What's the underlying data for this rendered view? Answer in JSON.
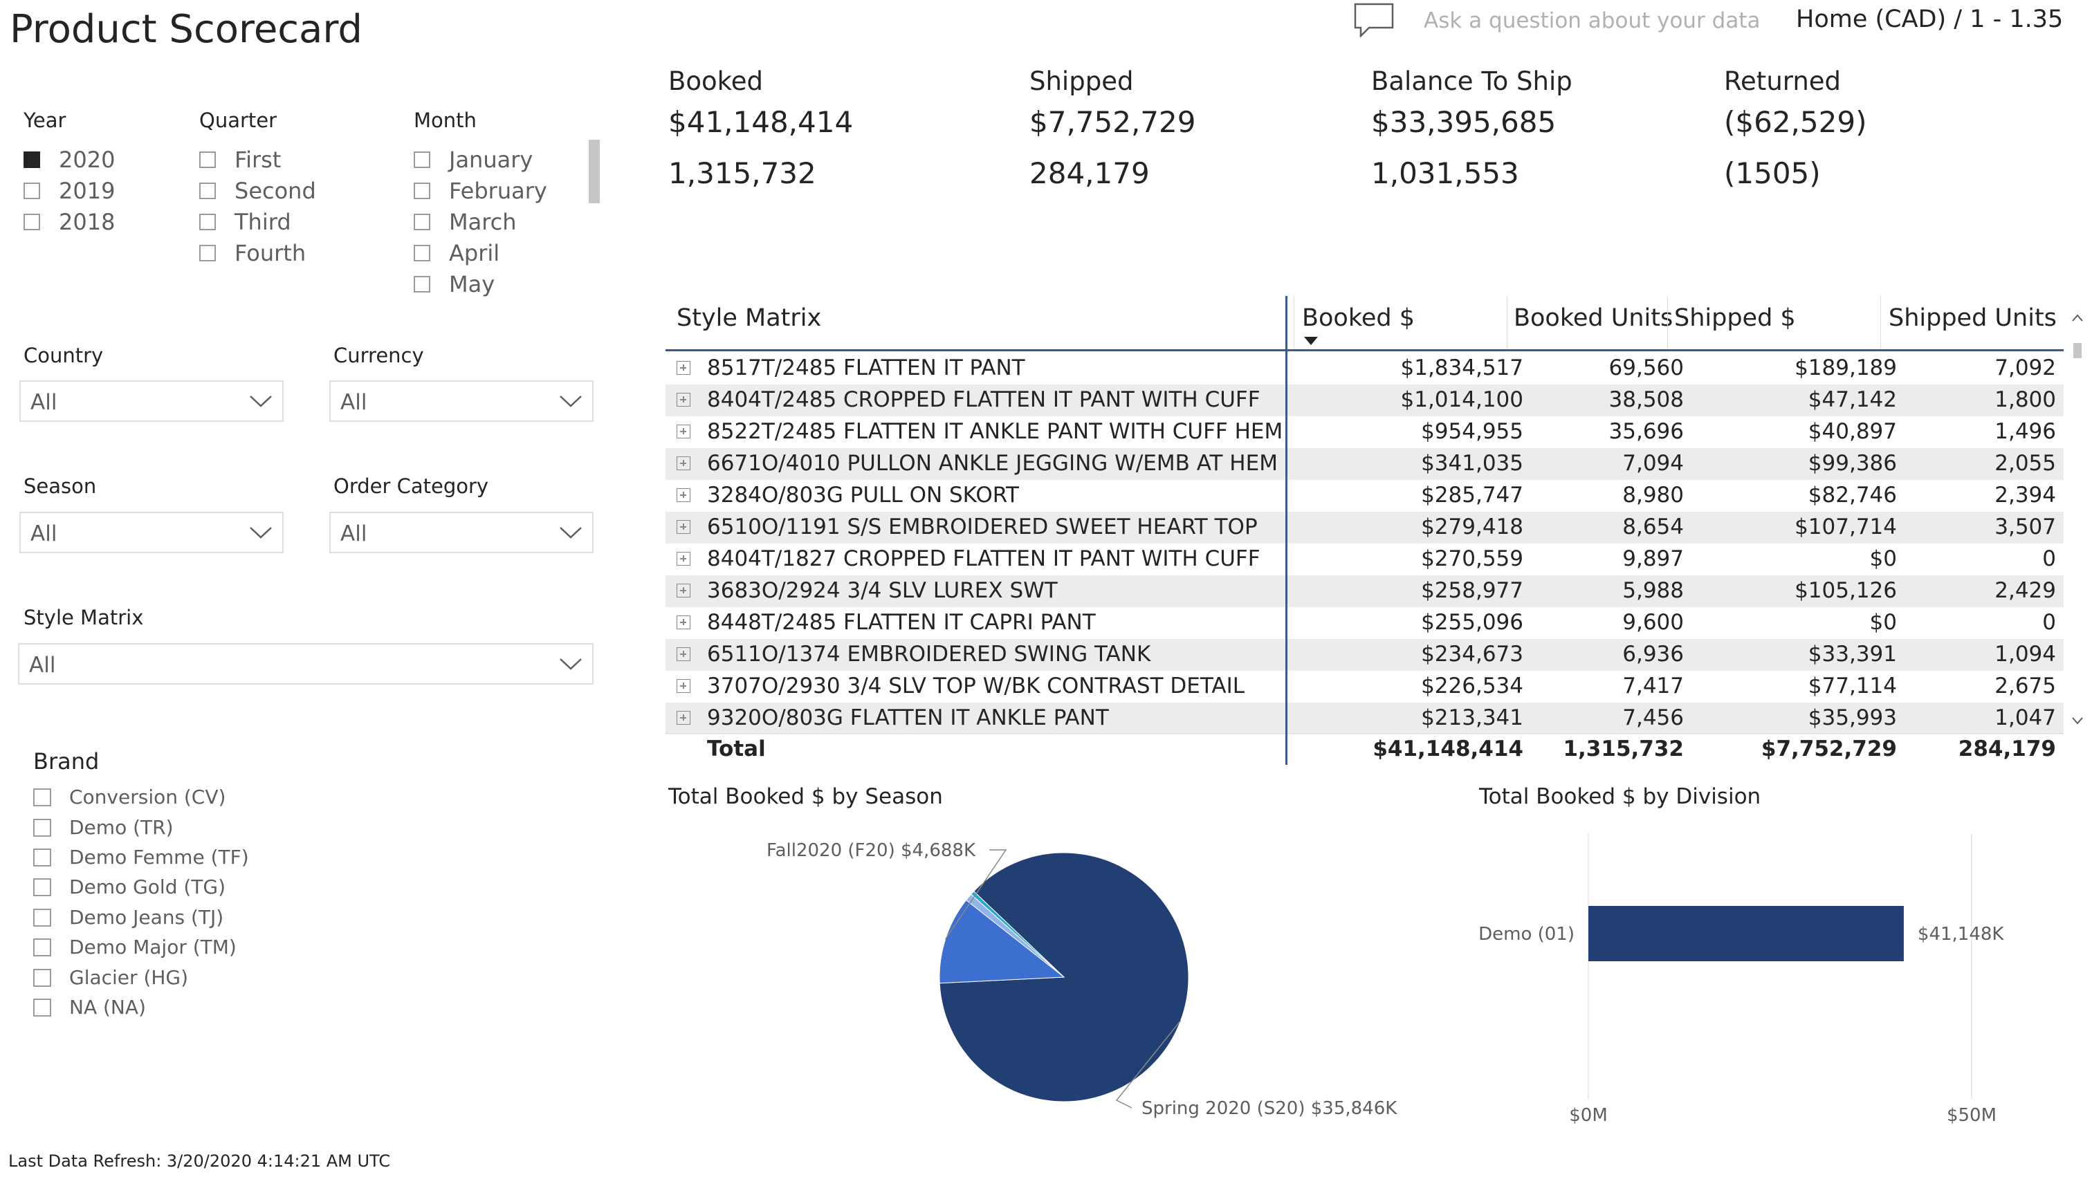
{
  "header": {
    "title": "Product Scorecard",
    "qa_placeholder": "Ask a question about your data",
    "currency_label": "Home (CAD) / 1 - 1.35",
    "qa_icon": "speech-bubble-icon"
  },
  "slicers": {
    "year": {
      "title": "Year",
      "options": [
        "2020",
        "2019",
        "2018"
      ],
      "selected": "2020"
    },
    "quarter": {
      "title": "Quarter",
      "options": [
        "First",
        "Second",
        "Third",
        "Fourth"
      ]
    },
    "month": {
      "title": "Month",
      "options": [
        "January",
        "February",
        "March",
        "April",
        "May"
      ]
    },
    "country": {
      "title": "Country",
      "value": "All"
    },
    "currency": {
      "title": "Currency",
      "value": "All"
    },
    "season": {
      "title": "Season",
      "value": "All"
    },
    "order_category": {
      "title": "Order Category",
      "value": "All"
    },
    "style_matrix": {
      "title": "Style Matrix",
      "value": "All"
    },
    "brand": {
      "title": "Brand",
      "options": [
        "Conversion (CV)",
        "Demo (TR)",
        "Demo Femme (TF)",
        "Demo Gold (TG)",
        "Demo Jeans (TJ)",
        "Demo Major (TM)",
        "Glacier (HG)",
        "NA (NA)"
      ]
    }
  },
  "kpis": [
    {
      "label": "Booked",
      "amount": "$41,148,414",
      "units": "1,315,732"
    },
    {
      "label": "Shipped",
      "amount": "$7,752,729",
      "units": "284,179"
    },
    {
      "label": "Balance To Ship",
      "amount": "$33,395,685",
      "units": "1,031,553"
    },
    {
      "label": "Returned",
      "amount": "($62,529)",
      "units": "(1505)"
    }
  ],
  "table": {
    "columns": [
      "Style Matrix",
      "Booked $",
      "Booked Units",
      "Shipped $",
      "Shipped Units"
    ],
    "rows": [
      [
        "8517T/2485 FLATTEN IT PANT",
        "$1,834,517",
        "69,560",
        "$189,189",
        "7,092"
      ],
      [
        "8404T/2485 CROPPED FLATTEN IT PANT WITH CUFF",
        "$1,014,100",
        "38,508",
        "$47,142",
        "1,800"
      ],
      [
        "8522T/2485 FLATTEN IT ANKLE PANT WITH CUFF HEM",
        "$954,955",
        "35,696",
        "$40,897",
        "1,496"
      ],
      [
        "6671O/4010 PULLON ANKLE JEGGING W/EMB AT HEM",
        "$341,035",
        "7,094",
        "$99,386",
        "2,055"
      ],
      [
        "3284O/803G PULL ON SKORT",
        "$285,747",
        "8,980",
        "$82,746",
        "2,394"
      ],
      [
        "6510O/1191 S/S EMBROIDERED SWEET HEART TOP",
        "$279,418",
        "8,654",
        "$107,714",
        "3,507"
      ],
      [
        "8404T/1827 CROPPED FLATTEN IT PANT WITH CUFF",
        "$270,559",
        "9,897",
        "$0",
        "0"
      ],
      [
        "3683O/2924 3/4 SLV LUREX SWT",
        "$258,977",
        "5,988",
        "$105,126",
        "2,429"
      ],
      [
        "8448T/2485 FLATTEN IT CAPRI PANT",
        "$255,096",
        "9,600",
        "$0",
        "0"
      ],
      [
        "6511O/1374 EMBROIDERED SWING TANK",
        "$234,673",
        "6,936",
        "$33,391",
        "1,094"
      ],
      [
        "3707O/2930 3/4 SLV TOP W/BK CONTRAST DETAIL",
        "$226,534",
        "7,417",
        "$77,114",
        "2,675"
      ],
      [
        "9320O/803G FLATTEN IT ANKLE PANT",
        "$213,341",
        "7,456",
        "$35,993",
        "1,047"
      ]
    ],
    "total": [
      "Total",
      "$41,148,414",
      "1,315,732",
      "$7,752,729",
      "284,179"
    ]
  },
  "chart_data": [
    {
      "type": "pie",
      "title": "Total Booked $ by Season",
      "slices": [
        {
          "label": "Spring 2020 (S20)",
          "value": 35846,
          "display": "Spring 2020 (S20) $35,846K",
          "color": "#223f73"
        },
        {
          "label": "Fall2020 (F20)",
          "value": 4688,
          "display": "Fall2020 (F20) $4,688K",
          "color": "#3c6fcf"
        },
        {
          "label": "",
          "value": 400,
          "display": "",
          "color": "#8fb3ea"
        },
        {
          "label": "",
          "value": 214,
          "display": "",
          "color": "#29a9c9"
        }
      ]
    },
    {
      "type": "bar",
      "title": "Total Booked $ by Division",
      "categories": [
        "Demo (01)"
      ],
      "values": [
        41148
      ],
      "value_labels": [
        "$41,148K"
      ],
      "xlim": [
        0,
        50000
      ],
      "xticks": [
        "$0M",
        "$50M"
      ],
      "color": "#223f73"
    }
  ],
  "footer": {
    "refresh": "Last Data Refresh: 3/20/2020 4:14:21 AM UTC"
  },
  "colors": {
    "accent": "#223f73",
    "row_alt": "#ececec",
    "header_line": "#3b5a86"
  }
}
